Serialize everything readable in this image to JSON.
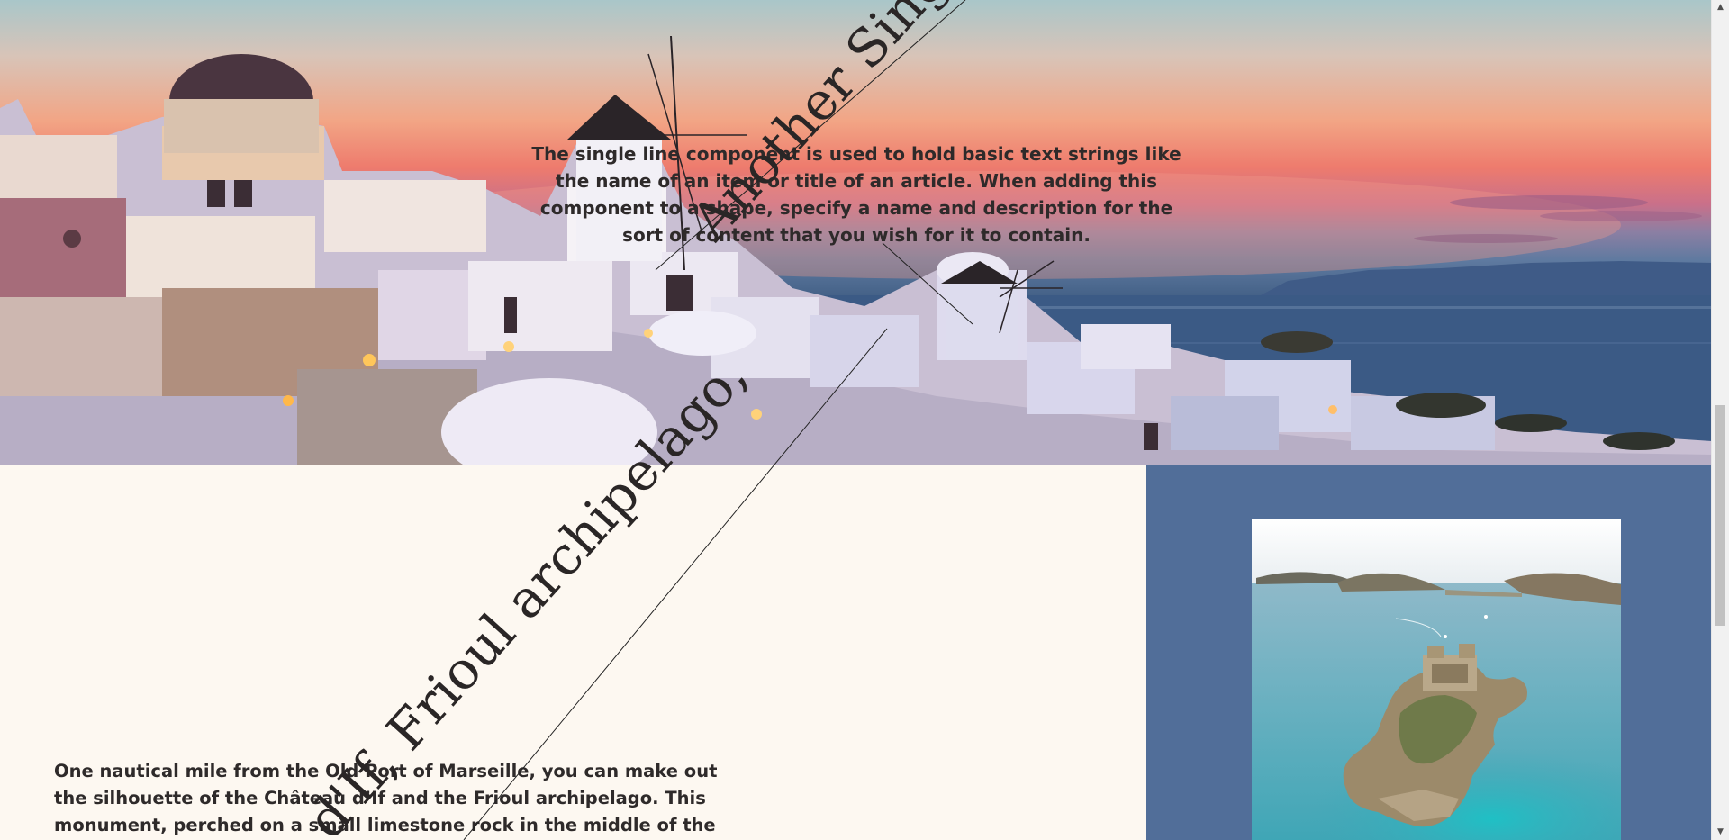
{
  "hero": {
    "description": "The single line component is used to hold basic text strings like the name of an item or title of an article. When adding this component to a shape, specify a name and description for the sort of content that you wish for it to contain."
  },
  "rotated_titles": {
    "top": "Another Single",
    "bottom": "d'If, Frioul archipelago,"
  },
  "article": {
    "body": "One nautical mile from the Old Port of Marseille, you can make out the silhouette of the Château d’If and the Frioul archipelago. This monument, perched on a small limestone rock in the middle of the Mediterranean"
  },
  "colors": {
    "page_background": "#fdf8f1",
    "side_panel": "#516e99",
    "text": "#2e2a2a"
  },
  "icons": {
    "scroll_up": "triangle-up-icon",
    "scroll_down": "triangle-down-icon"
  }
}
